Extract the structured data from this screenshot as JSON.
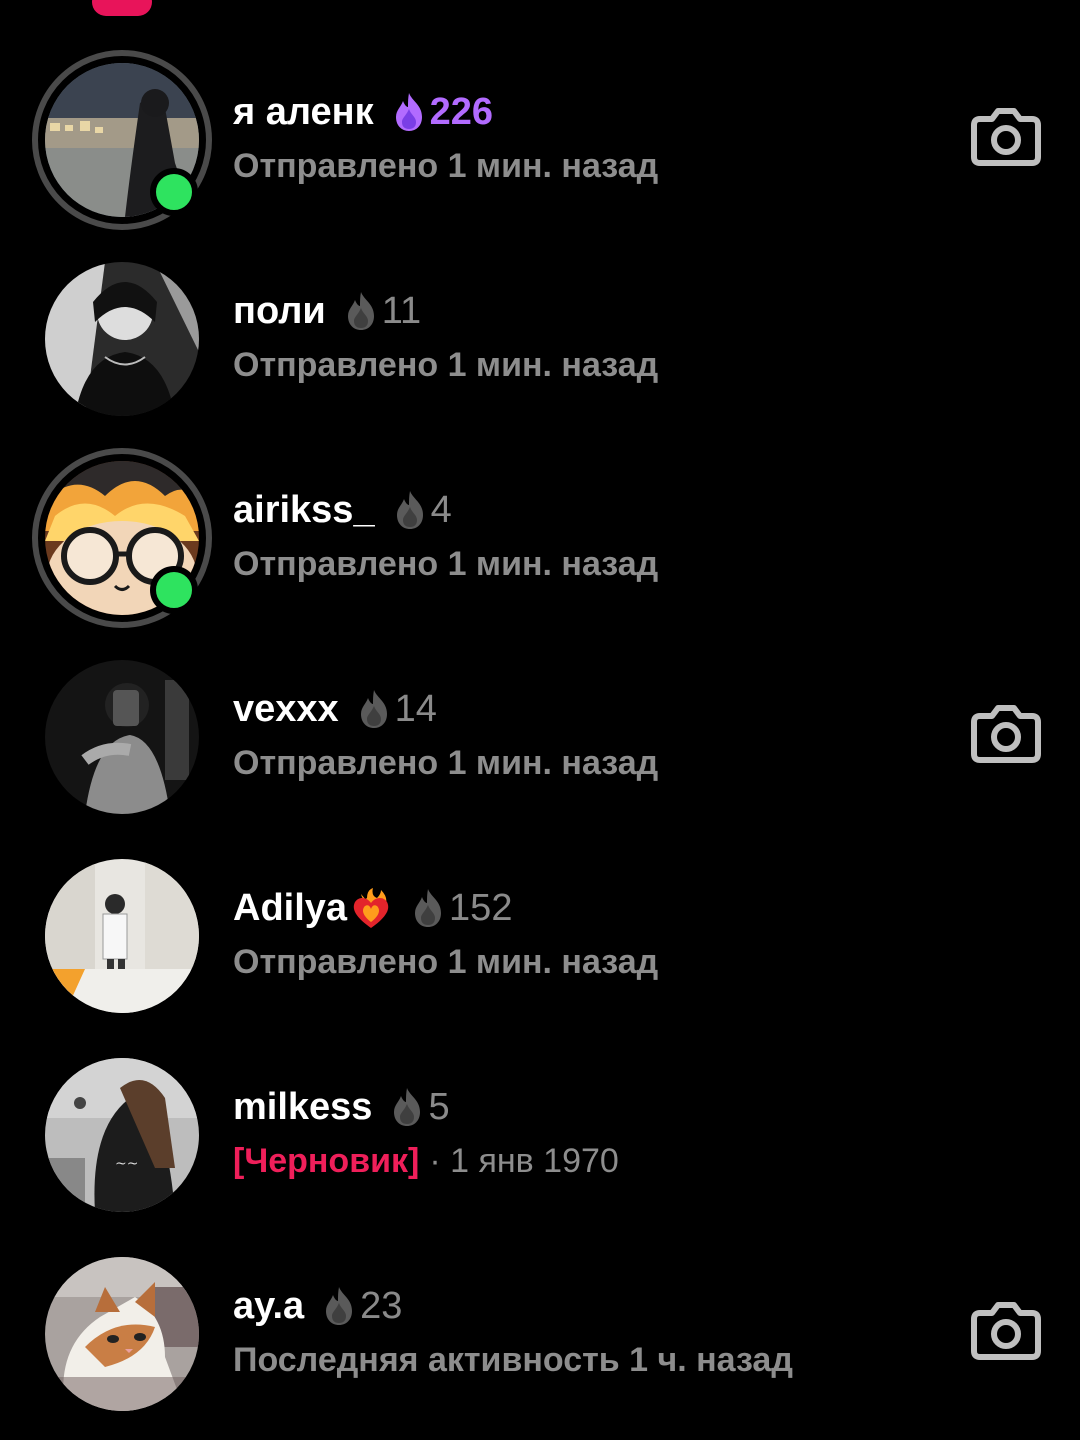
{
  "colors": {
    "background": "#000000",
    "online": "#2ee35f",
    "streak_hot": "#b26bff",
    "streak_grey": "#8a8a8a",
    "draft": "#ef1f5a",
    "status_text": "#8d8d8d"
  },
  "chats": [
    {
      "username": "я аленк",
      "streak": "226",
      "streak_style": "hot",
      "status": "Отправлено 1 мин. назад",
      "online": true,
      "has_ring": true,
      "camera": true,
      "avatar": "city-night-photo"
    },
    {
      "username": "поли",
      "streak": "11",
      "streak_style": "grey",
      "status": "Отправлено 1 мин. назад",
      "online": false,
      "has_ring": false,
      "camera": false,
      "avatar": "bw-portrait"
    },
    {
      "username": "airikss_",
      "streak": "4",
      "streak_style": "grey",
      "status": "Отправлено 1 мин. назад",
      "online": true,
      "has_ring": true,
      "camera": false,
      "avatar": "cartoon-glasses"
    },
    {
      "username": "vexxx",
      "streak": "14",
      "streak_style": "grey",
      "status": "Отправлено 1 мин. назад",
      "online": false,
      "has_ring": false,
      "camera": true,
      "avatar": "mirror-selfie-dark"
    },
    {
      "username": "Adilya",
      "emoji": "heart-on-fire",
      "streak": "152",
      "streak_style": "grey",
      "status": "Отправлено 1 мин. назад",
      "online": false,
      "has_ring": false,
      "camera": false,
      "avatar": "mirror-selfie-light"
    },
    {
      "username": "milkess",
      "streak": "5",
      "streak_style": "grey",
      "draft_label": "[Черновик]",
      "draft_date": "· 1 янв 1970",
      "online": false,
      "has_ring": false,
      "camera": false,
      "avatar": "hoodie-photo"
    },
    {
      "username": "ay.a",
      "streak": "23",
      "streak_style": "grey",
      "status": "Последняя активность 1 ч. назад",
      "online": false,
      "has_ring": false,
      "camera": true,
      "avatar": "cat-photo"
    }
  ]
}
